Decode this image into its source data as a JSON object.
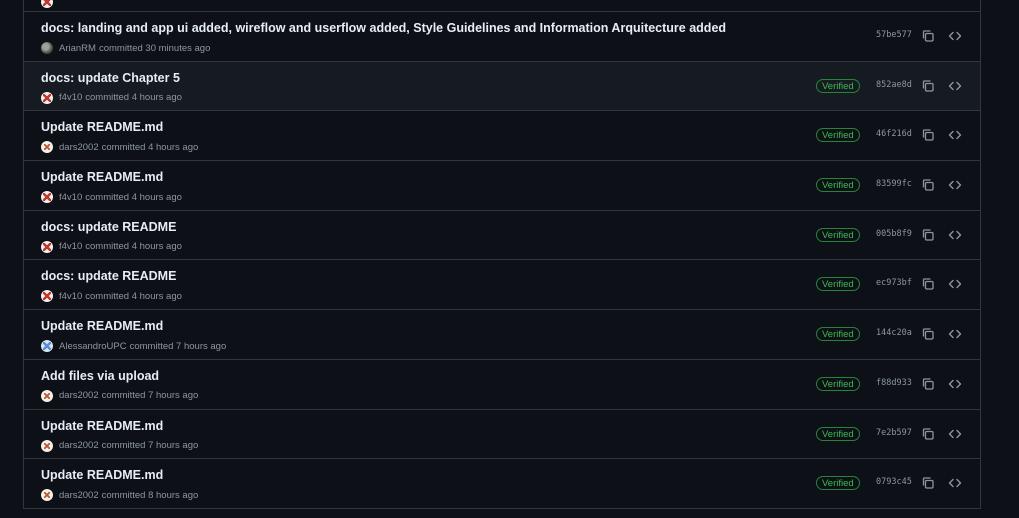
{
  "commits": [
    {
      "title": "",
      "author": "",
      "time": "",
      "avatar": "f4v10",
      "verified": "",
      "sha": "",
      "partial": true
    },
    {
      "title": "docs: landing and app ui added, wireflow and userflow added, Style Guidelines and Information Arquitecture added",
      "author": "ArianRM",
      "time": "committed 30 minutes ago",
      "avatar": "arian",
      "verified": "",
      "sha": "57be577"
    },
    {
      "title": "docs: update Chapter 5",
      "author": "f4v10",
      "time": "committed 4 hours ago",
      "avatar": "f4v10",
      "verified": "Verified",
      "sha": "852ae8d",
      "hover": true
    },
    {
      "title": "Update README.md",
      "author": "dars2002",
      "time": "committed 4 hours ago",
      "avatar": "dars",
      "verified": "Verified",
      "sha": "46f216d"
    },
    {
      "title": "Update README.md",
      "author": "f4v10",
      "time": "committed 4 hours ago",
      "avatar": "f4v10",
      "verified": "Verified",
      "sha": "83599fc"
    },
    {
      "title": "docs: update README",
      "author": "f4v10",
      "time": "committed 4 hours ago",
      "avatar": "f4v10",
      "verified": "Verified",
      "sha": "005b8f9"
    },
    {
      "title": "docs: update README",
      "author": "f4v10",
      "time": "committed 4 hours ago",
      "avatar": "f4v10",
      "verified": "Verified",
      "sha": "ec973bf"
    },
    {
      "title": "Update README.md",
      "author": "AlessandroUPC",
      "time": "committed 7 hours ago",
      "avatar": "aless",
      "verified": "Verified",
      "sha": "144c20a"
    },
    {
      "title": "Add files via upload",
      "author": "dars2002",
      "time": "committed 7 hours ago",
      "avatar": "dars",
      "verified": "Verified",
      "sha": "f88d933"
    },
    {
      "title": "Update README.md",
      "author": "dars2002",
      "time": "committed 7 hours ago",
      "avatar": "dars",
      "verified": "Verified",
      "sha": "7e2b597"
    },
    {
      "title": "Update README.md",
      "author": "dars2002",
      "time": "committed 8 hours ago",
      "avatar": "dars",
      "verified": "Verified",
      "sha": "0793c45"
    }
  ],
  "icons": {
    "copy": "copy-icon",
    "code": "code-icon"
  },
  "colors": {
    "background": "#0d1117",
    "row_hover": "#161b22",
    "border": "#30363d",
    "verified_text": "#3fb950",
    "verified_border": "#238636",
    "muted": "#8d96a0"
  }
}
